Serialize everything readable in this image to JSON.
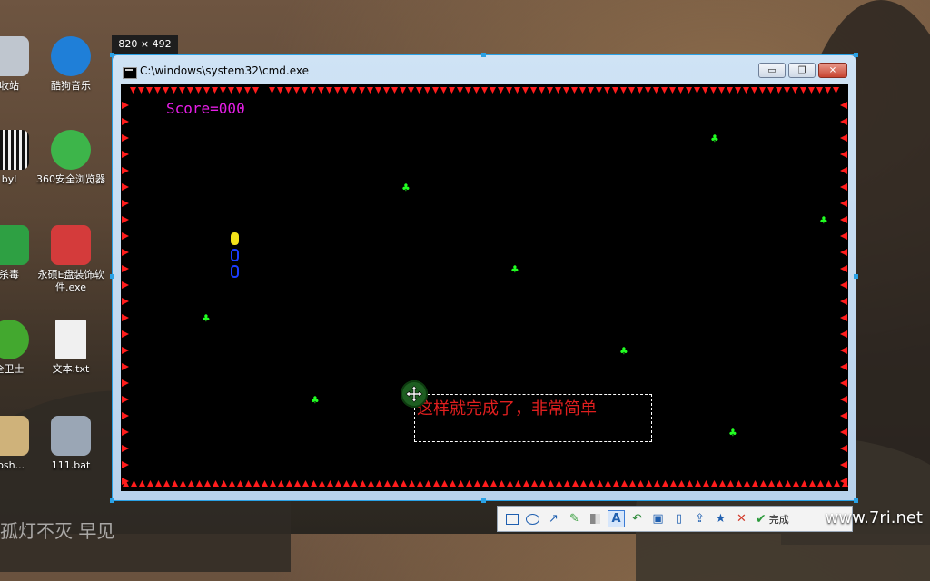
{
  "desktop": {
    "icons": [
      {
        "label": "收站",
        "color": "#bfc6cf"
      },
      {
        "label": "酷狗音乐",
        "color": "#1f7fd8"
      },
      {
        "label": "byl",
        "color": "#ececec"
      },
      {
        "label": "360安全浏览器",
        "color": "#3db54a"
      },
      {
        "label": "杀毒",
        "color": "#2ea043"
      },
      {
        "label": "永硕E盘装饰软件.exe",
        "color": "#d43b3b"
      },
      {
        "label": "全卫士",
        "color": "#43a82f"
      },
      {
        "label": "文本.txt",
        "color": "#f0f0f0"
      },
      {
        "label": "tosh...",
        "color": "#cfb27a"
      },
      {
        "label": "111.bat",
        "color": "#9aa6b5"
      }
    ]
  },
  "capture": {
    "size_label": "820 × 492"
  },
  "window": {
    "title": "C:\\windows\\system32\\cmd.exe",
    "min_label": "▭",
    "max_label": "❐",
    "close_label": "✕"
  },
  "game": {
    "score_text": "Score=000",
    "food_char": "♣",
    "colors": {
      "wall": "#ff1c1c",
      "score": "#e61ee6",
      "food": "#22ff22",
      "snake_head": "#f4e21a",
      "snake_body": "#1a3cff"
    }
  },
  "annotation": {
    "text": "这样就完成了，非常简单"
  },
  "toolbar": {
    "items": [
      "rectangle-tool",
      "ellipse-tool",
      "arrow-tool",
      "pen-tool",
      "mosaic-tool",
      "text-tool",
      "undo",
      "save",
      "copy",
      "share",
      "pin",
      "cancel",
      "done"
    ],
    "done_label": "完成"
  },
  "watermark": "www.7ri.net",
  "bottom_text": "孤灯不灭  早见",
  "bottom_text_note": ""
}
